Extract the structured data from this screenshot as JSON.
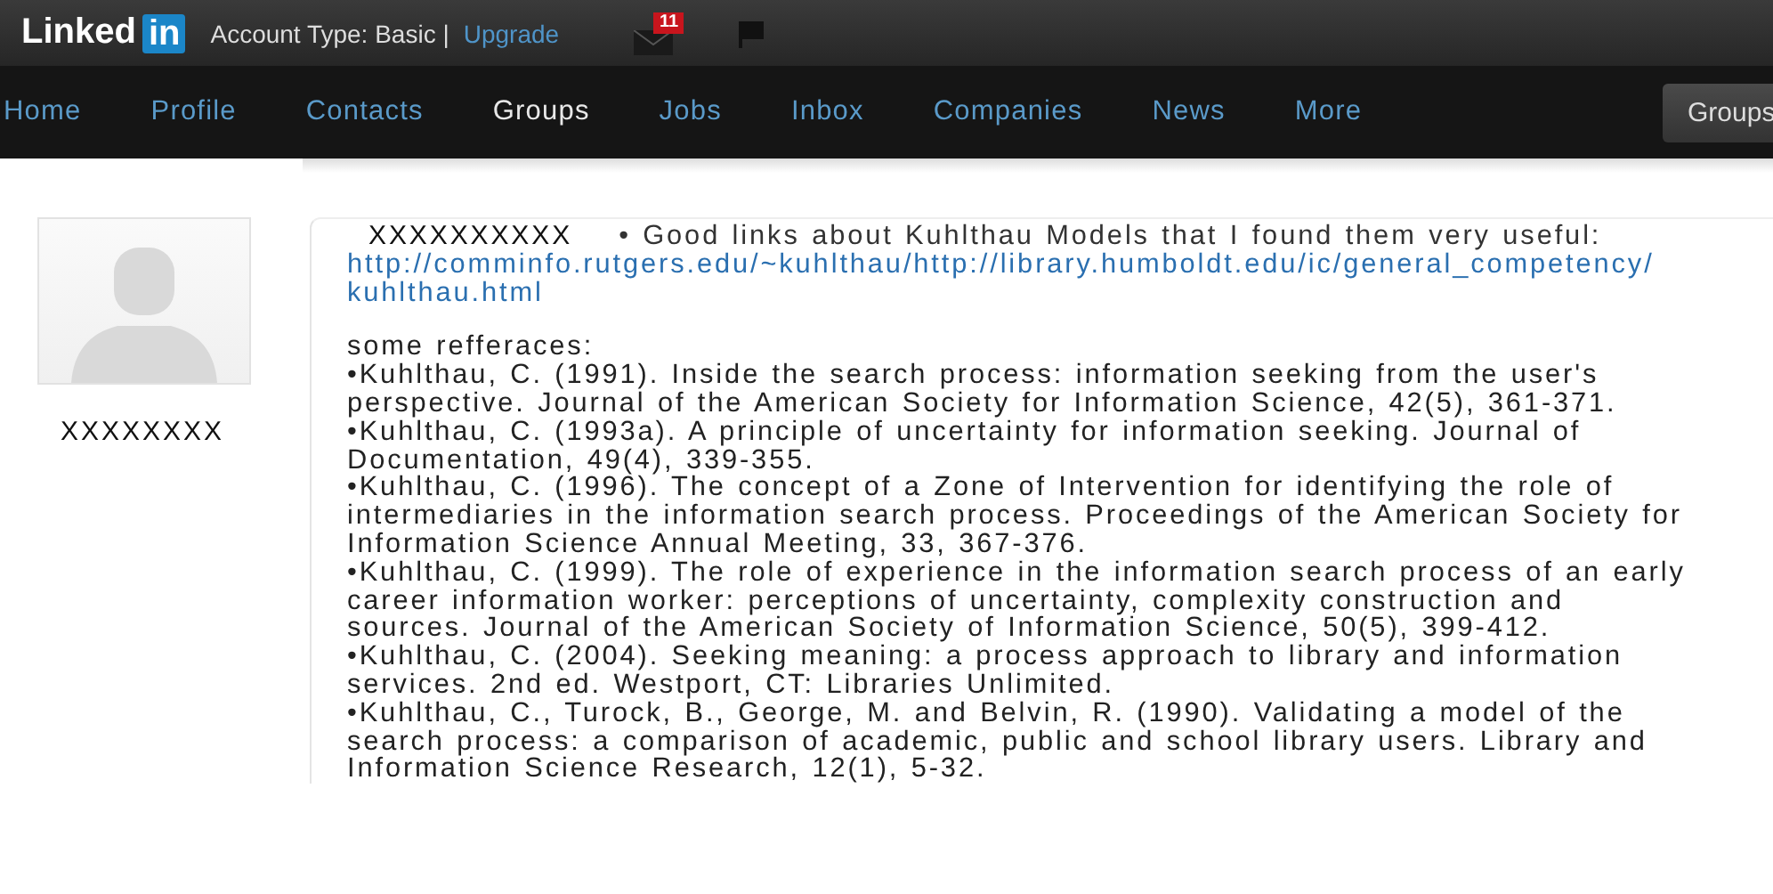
{
  "header": {
    "logo_word": "Linked",
    "logo_badge": "in",
    "account_label": "Account Type: Basic |",
    "upgrade_link": "Upgrade",
    "message_count": "11"
  },
  "nav": {
    "items": [
      {
        "label": "Home",
        "selected": false
      },
      {
        "label": "Profile",
        "selected": false
      },
      {
        "label": "Contacts",
        "selected": false
      },
      {
        "label": "Groups",
        "selected": true
      },
      {
        "label": "Jobs",
        "selected": false
      },
      {
        "label": "Inbox",
        "selected": false
      },
      {
        "label": "Companies",
        "selected": false
      },
      {
        "label": "News",
        "selected": false
      },
      {
        "label": "More",
        "selected": false
      }
    ],
    "search_scope": "Groups"
  },
  "post": {
    "author_name": "XXXXXXXX",
    "header_name": "XXXXXXXXXX",
    "intro": "• Good links about Kuhlthau Models that I found them very useful:",
    "link_lines": [
      "http://comminfo.rutgers.edu/~kuhlthau/http://library.humboldt.edu/ic/general_competency/",
      "kuhlthau.html"
    ],
    "refs_heading": "some refferaces:",
    "references": [
      {
        "lines": [
          "•Kuhlthau, C. (1991). Inside the search process: information seeking from the user's",
          "perspective. Journal of the American Society for Information Science, 42(5), 361-371."
        ]
      },
      {
        "lines": [
          "•Kuhlthau, C. (1993a). A principle of uncertainty for information seeking. Journal of",
          "Documentation, 49(4), 339-355."
        ]
      },
      {
        "lines": [
          "•Kuhlthau, C. (1996). The concept of a Zone of Intervention for identifying the role of",
          "intermediaries in the information search process. Proceedings of the American Society for",
          "Information Science Annual Meeting, 33, 367-376."
        ]
      },
      {
        "lines": [
          "•Kuhlthau, C. (1999). The role of experience in the information search process of an early",
          "career information worker: perceptions of uncertainty, complexity construction and",
          "sources. Journal of the American Society of Information Science, 50(5), 399-412."
        ]
      },
      {
        "lines": [
          "•Kuhlthau, C. (2004). Seeking meaning: a process approach to library and information",
          "services. 2nd ed. Westport, CT: Libraries Unlimited."
        ]
      },
      {
        "lines": [
          "•Kuhlthau, C., Turock, B., George, M. and Belvin, R. (1990). Validating a model of the",
          "search process: a comparison of academic, public and school library users. Library and",
          "Information Science Research, 12(1), 5-32."
        ]
      }
    ]
  }
}
